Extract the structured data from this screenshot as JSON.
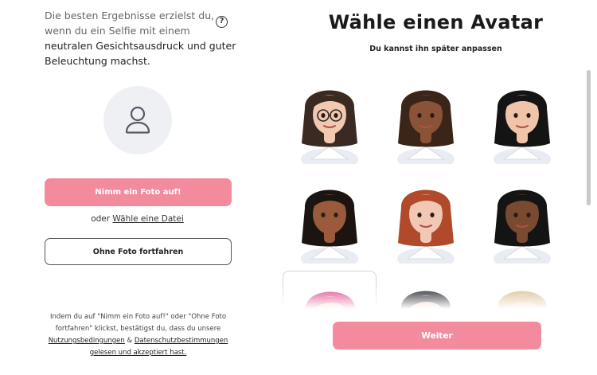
{
  "intro": {
    "line_muted": "Die besten Ergebnisse erzielst du, wenn du ein Selfie mit einem",
    "line_strong": "neutralen Gesichtsausdruck und guter Beleuchtung machst."
  },
  "help_symbol": "?",
  "buttons": {
    "take_photo": "Nimm ein Foto auf!",
    "or_prefix": "oder",
    "choose_file": "Wähle eine Datei",
    "no_photo": "Ohne Foto fortfahren",
    "continue": "Weiter"
  },
  "terms": {
    "text": "Indem du auf \"Nimm ein Foto auf!\" oder \"Ohne Foto fortfahren\" klickst, bestätigst du, dass du unsere",
    "terms_link": "Nutzungsbedingungen",
    "amp": "&",
    "privacy_link": "Datenschutzbestimmungen gelesen und akzeptiert hast."
  },
  "avatar_picker": {
    "title": "Wähle einen Avatar",
    "subtitle": "Du kannst ihn später anpassen",
    "avatars": [
      {
        "hair": "#3a2a22",
        "skin": "#f1c8b0",
        "glasses": true
      },
      {
        "hair": "#3b2418",
        "skin": "#8a5236",
        "glasses": false
      },
      {
        "hair": "#141414",
        "skin": "#f0c4a8",
        "glasses": false
      },
      {
        "hair": "#1c1410",
        "skin": "#9a5a3c",
        "glasses": false
      },
      {
        "hair": "#b04a2a",
        "skin": "#f2c8b4",
        "glasses": false
      },
      {
        "hair": "#141414",
        "skin": "#7a4a30",
        "glasses": false
      },
      {
        "hair": "#e0458a",
        "skin": "#f2c3b3",
        "glasses": false,
        "selected": true
      },
      {
        "hair": "#1a1a22",
        "skin": "#f0c6ae",
        "glasses": false
      },
      {
        "hair": "#d9bd8f",
        "skin": "#f2c9b5",
        "glasses": false
      }
    ]
  },
  "colors": {
    "accent": "#f28c9d",
    "placeholder_bg": "#eef0f4"
  }
}
